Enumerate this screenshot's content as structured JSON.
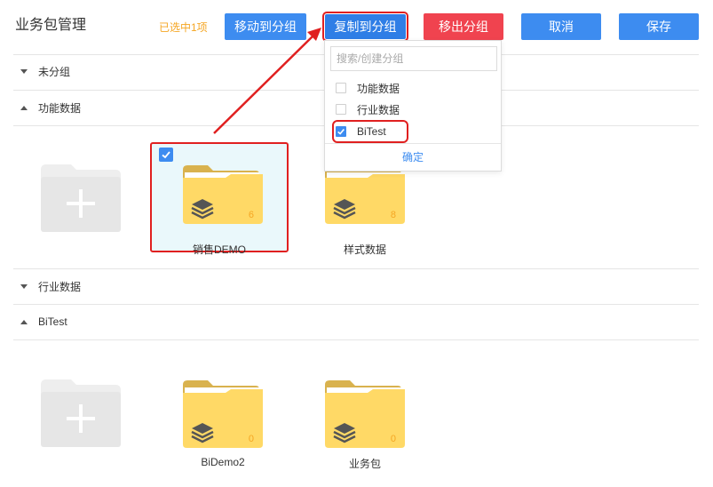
{
  "header": {
    "title": "业务包管理",
    "selected_count": "已选中1项",
    "buttons": {
      "move": "移动到分组",
      "copy": "复制到分组",
      "remove": "移出分组",
      "cancel": "取消",
      "save": "保存"
    }
  },
  "colors": {
    "primary": "#3d8cf0",
    "danger": "#f0434f",
    "warning_text": "#f5a623",
    "highlight_border": "#e02020",
    "folder_yellow": "#ffd966",
    "selected_bg": "#eaf8fb"
  },
  "groups": [
    {
      "name": "未分组",
      "expanded": false
    },
    {
      "name": "功能数据",
      "expanded": true,
      "tiles": [
        {
          "type": "add",
          "icon": "add-folder-icon"
        },
        {
          "type": "package",
          "label": "销售DEMO",
          "count": "6",
          "selected": true
        },
        {
          "type": "package",
          "label": "样式数据",
          "count": "8",
          "selected": false
        }
      ]
    },
    {
      "name": "行业数据",
      "expanded": false
    },
    {
      "name": "BiTest",
      "expanded": true,
      "tiles": [
        {
          "type": "add",
          "icon": "add-folder-icon"
        },
        {
          "type": "package",
          "label": "BiDemo2",
          "count": "0",
          "selected": false
        },
        {
          "type": "package",
          "label": "业务包",
          "count": "0",
          "selected": false
        }
      ]
    }
  ],
  "dropdown": {
    "search_placeholder": "搜索/创建分组",
    "options": [
      {
        "label": "功能数据",
        "checked": false
      },
      {
        "label": "行业数据",
        "checked": false
      },
      {
        "label": "BiTest",
        "checked": true
      }
    ],
    "confirm": "确定"
  }
}
